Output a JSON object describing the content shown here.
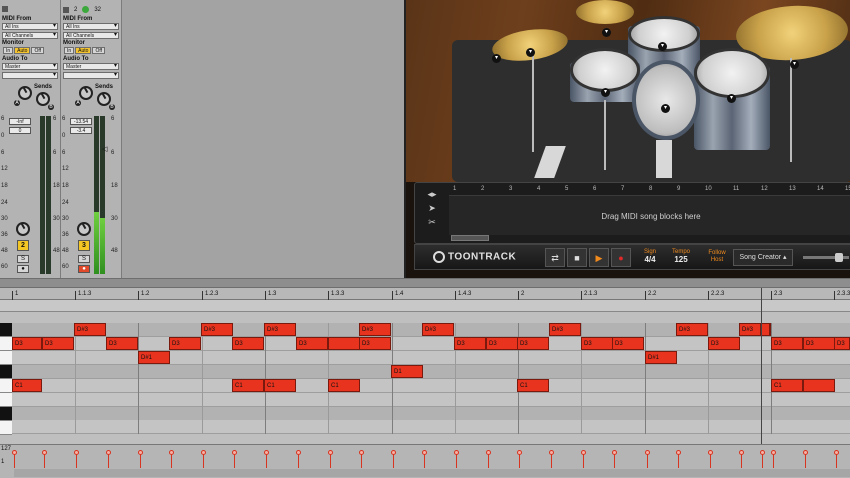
{
  "mixer": {
    "tracks": [
      {
        "midi_from_label": "MIDI From",
        "midi_from_value": "All Ins",
        "channel_value": "All Channels",
        "monitor_label": "Monitor",
        "monitor_options": [
          "In",
          "Auto",
          "Off"
        ],
        "monitor_selected": "Auto",
        "audio_to_label": "Audio To",
        "audio_to_value": "Master",
        "sends_label": "Sends",
        "send_a": "A",
        "send_b": "B",
        "volume_value": "-Inf",
        "pan_value": "0",
        "track_number": "2",
        "solo_label": "S",
        "record_label": "●",
        "scale": [
          "6",
          "0",
          "6",
          "12",
          "18",
          "24",
          "30",
          "36",
          "48",
          "60"
        ]
      },
      {
        "midi_from_label": "MIDI From",
        "midi_from_value": "All Ins",
        "channel_value": "All Channels",
        "monitor_label": "Monitor",
        "monitor_options": [
          "In",
          "Auto",
          "Off"
        ],
        "monitor_selected": "Auto",
        "audio_to_label": "Audio To",
        "audio_to_value": "Master",
        "sends_label": "Sends",
        "send_a": "A",
        "send_b": "B",
        "volume_value": "-13.54",
        "pan_value": "-3.4",
        "track_number": "3",
        "solo_label": "S",
        "record_label": "●",
        "top_numbers": [
          "2",
          "32"
        ],
        "scale": [
          "6",
          "0",
          "6",
          "12",
          "18",
          "24",
          "30",
          "36",
          "48",
          "60"
        ]
      }
    ]
  },
  "plugin": {
    "hint_text": "Drag MIDI song blocks here",
    "ruler_ticks": [
      "1",
      "2",
      "3",
      "4",
      "5",
      "6",
      "7",
      "8",
      "9",
      "10",
      "11",
      "12",
      "13",
      "14",
      "15"
    ],
    "logo_text": "TOONTRACK",
    "sign_label": "Sign",
    "sign_value": "4/4",
    "tempo_label": "Tempo",
    "tempo_value": "125",
    "follow_label": "Follow Host",
    "song_creator_label": "Song Creator ▴",
    "accent_color": "#f08a1c"
  },
  "piano_roll": {
    "ruler": [
      "1",
      "1.1.3",
      "1.2",
      "1.2.3",
      "1.3",
      "1.3.3",
      "1.4",
      "1.4.3",
      "2",
      "2.1.3",
      "2.2",
      "2.2.3",
      "2.3",
      "2.3.3"
    ],
    "velocity_top": "127",
    "velocity_bottom": "1",
    "note_color": "#e8341f",
    "notes": [
      {
        "pitch": "D#3",
        "label": "D#3"
      },
      {
        "pitch": "D3",
        "label": "D3"
      },
      {
        "pitch": "D#1",
        "label": "D#1"
      },
      {
        "pitch": "D1",
        "label": "D1"
      },
      {
        "pitch": "C1",
        "label": "C1"
      }
    ]
  }
}
